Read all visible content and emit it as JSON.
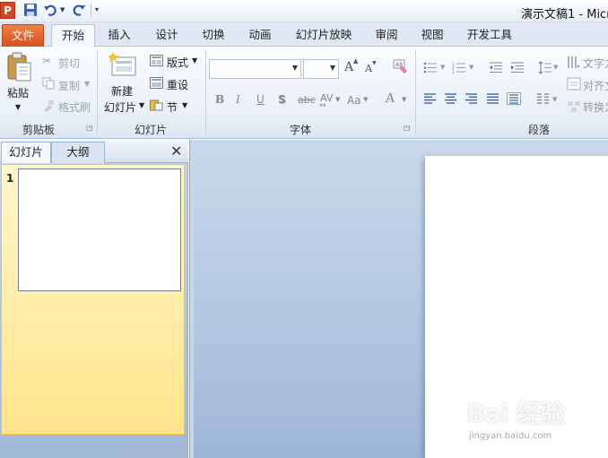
{
  "titlebar": {
    "app_logo": "P",
    "title": "演示文稿1 - Micr"
  },
  "tabs": {
    "file": "文件",
    "items": [
      "开始",
      "插入",
      "设计",
      "切换",
      "动画",
      "幻灯片放映",
      "审阅",
      "视图",
      "开发工具"
    ]
  },
  "ribbon": {
    "clipboard": {
      "paste": "粘贴",
      "cut": "剪切",
      "copy": "复制",
      "format_painter": "格式刷",
      "label": "剪贴板"
    },
    "slides": {
      "new_line1": "新建",
      "new_line2": "幻灯片",
      "layout": "版式",
      "reset": "重设",
      "section": "节",
      "label": "幻灯片"
    },
    "font": {
      "label": "字体",
      "bold": "B",
      "italic": "I",
      "underline": "U",
      "shadow": "S",
      "strike": "abc",
      "spacing": "AV",
      "case": "Aa",
      "color": "A",
      "grow": "A",
      "shrink": "A"
    },
    "paragraph": {
      "label": "段落",
      "text_direction": "文字方",
      "align_text": "对齐文",
      "convert": "转换为"
    }
  },
  "panel": {
    "tab_slides": "幻灯片",
    "tab_outline": "大纲",
    "close": "✕",
    "slide_number": "1"
  },
  "watermark": {
    "main": "Bai 经验",
    "sub": "jingyan.baidu.com"
  },
  "colors": {
    "file_tab": "#d5501e",
    "ribbon_bg": "#e7eef7",
    "workspace": "#b4c8e3",
    "thumb_highlight": "#ffe48a"
  }
}
